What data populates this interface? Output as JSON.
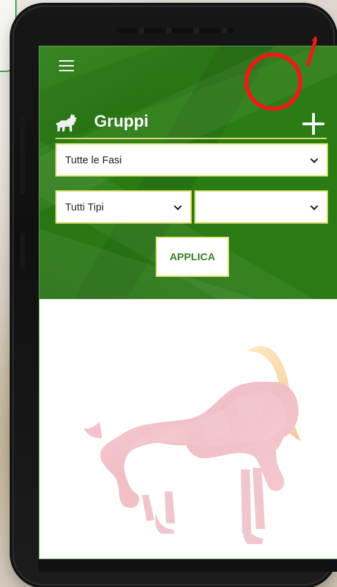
{
  "page": {
    "title": "Gruppi"
  },
  "header": {
    "menu_icon": "menu-icon",
    "title_icon": "goat-icon",
    "add_icon": "plus-icon"
  },
  "filters": {
    "phase_value": "Tutte le Fasi",
    "type_value": "Tutti Tipi",
    "secondary_value": "",
    "apply_label": "APPLICA"
  },
  "background": {
    "illustration": "goat-illustration"
  },
  "colors": {
    "header_green": "#2B7B15",
    "accent_yellow": "#E1E572",
    "highlight_red": "#EF1A17",
    "button_text_green": "#2F7B16"
  }
}
